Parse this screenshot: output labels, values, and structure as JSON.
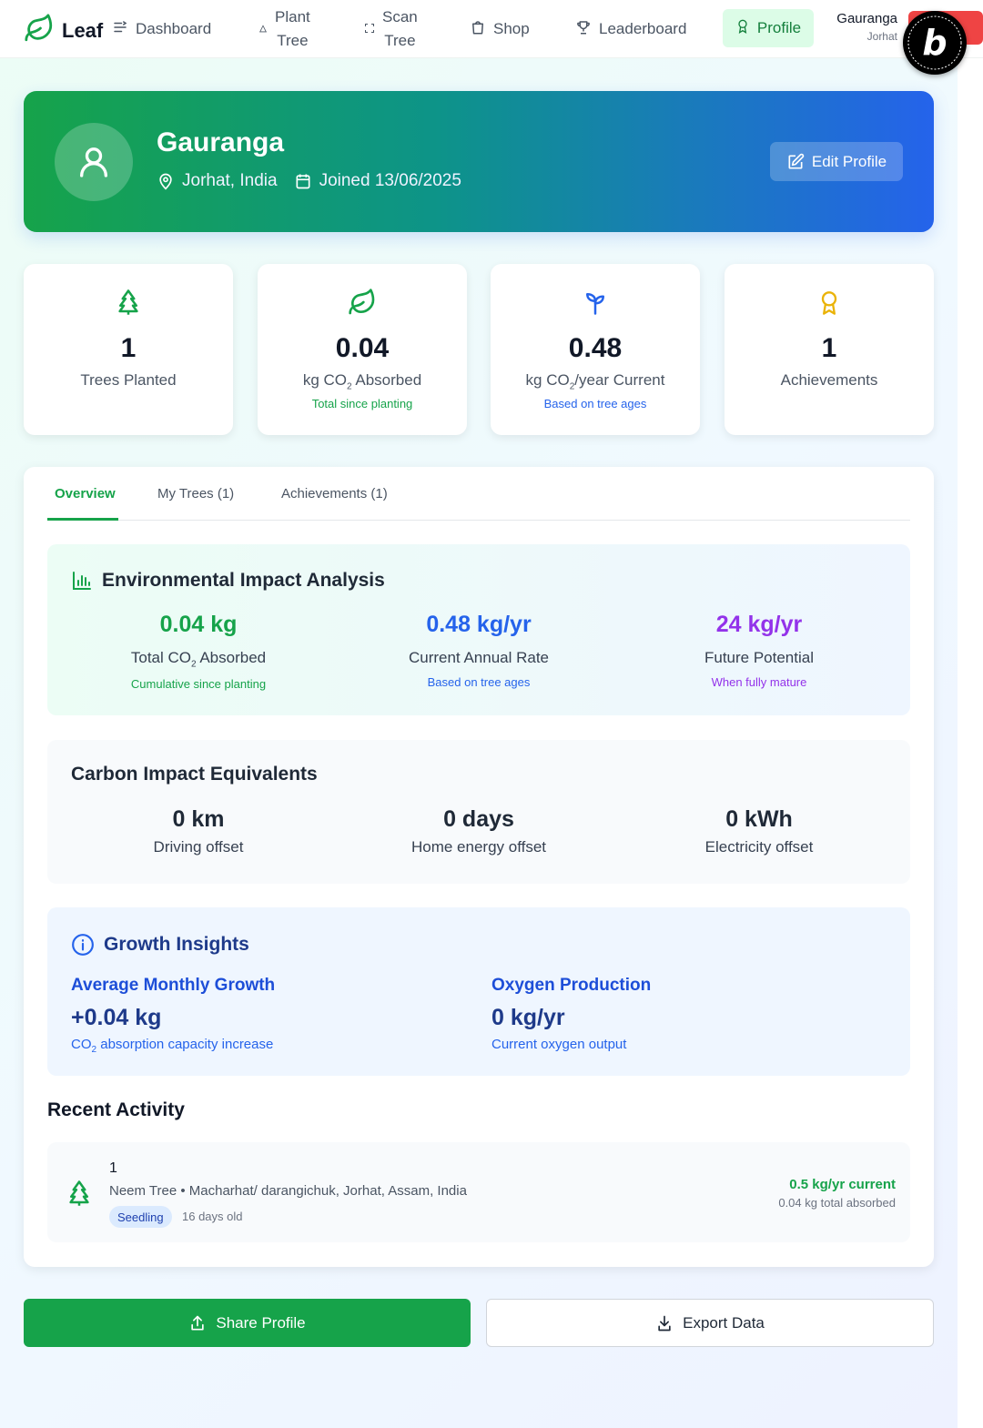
{
  "nav": {
    "brand": "Leaf",
    "items": {
      "dashboard": "Dashboard",
      "plant_tree_1": "Plant",
      "plant_tree_2": "Tree",
      "scan_tree_1": "Scan",
      "scan_tree_2": "Tree",
      "shop": "Shop",
      "leaderboard": "Leaderboard",
      "profile": "Profile"
    },
    "user": {
      "name": "Gauranga",
      "location": "Jorhat"
    }
  },
  "hero": {
    "name": "Gauranga",
    "location": "Jorhat, India",
    "joined": "Joined 13/06/2025",
    "edit_label": "Edit Profile"
  },
  "stats": {
    "trees": {
      "value": "1",
      "label": "Trees Planted"
    },
    "absorbed": {
      "value": "0.04",
      "label_pre": "kg CO",
      "label_sub": "2",
      "label_post": " Absorbed",
      "sub": "Total since planting"
    },
    "rate": {
      "value": "0.48",
      "label_pre": "kg CO",
      "label_sub": "2",
      "label_post": "/year Current",
      "sub": "Based on tree ages"
    },
    "achievements": {
      "value": "1",
      "label": "Achievements"
    }
  },
  "tabs": {
    "overview": "Overview",
    "my_trees": "My Trees (1)",
    "achievements": "Achievements (1)"
  },
  "impact": {
    "title": "Environmental Impact Analysis",
    "total": {
      "value": "0.04 kg",
      "label_pre": "Total CO",
      "label_sub": "2",
      "label_post": " Absorbed",
      "sub": "Cumulative since planting"
    },
    "annual": {
      "value": "0.48 kg/yr",
      "label": "Current Annual Rate",
      "sub": "Based on tree ages"
    },
    "future": {
      "value": "24 kg/yr",
      "label": "Future Potential",
      "sub": "When fully mature"
    }
  },
  "equivalents": {
    "title": "Carbon Impact Equivalents",
    "driving": {
      "value": "0 km",
      "label": "Driving offset"
    },
    "home": {
      "value": "0 days",
      "label": "Home energy offset"
    },
    "electricity": {
      "value": "0 kWh",
      "label": "Electricity offset"
    }
  },
  "growth": {
    "title": "Growth Insights",
    "monthly": {
      "heading": "Average Monthly Growth",
      "value": "+0.04 kg",
      "desc_pre": "CO",
      "desc_sub": "2",
      "desc_post": " absorption capacity increase"
    },
    "oxygen": {
      "heading": "Oxygen Production",
      "value": "0 kg/yr",
      "desc": "Current oxygen output"
    }
  },
  "recent": {
    "title": "Recent Activity",
    "item": {
      "title": "1",
      "desc": "Neem Tree • Macharhat/ darangichuk, Jorhat, Assam, India",
      "badge": "Seedling",
      "age": "16 days old",
      "rate": "0.5 kg/yr current",
      "total": "0.04 kg total absorbed"
    }
  },
  "actions": {
    "share": "Share Profile",
    "export": "Export Data"
  },
  "colors": {
    "green": "#16a34a",
    "blue": "#2563eb",
    "purple": "#9333ea",
    "yellow": "#eab308"
  }
}
